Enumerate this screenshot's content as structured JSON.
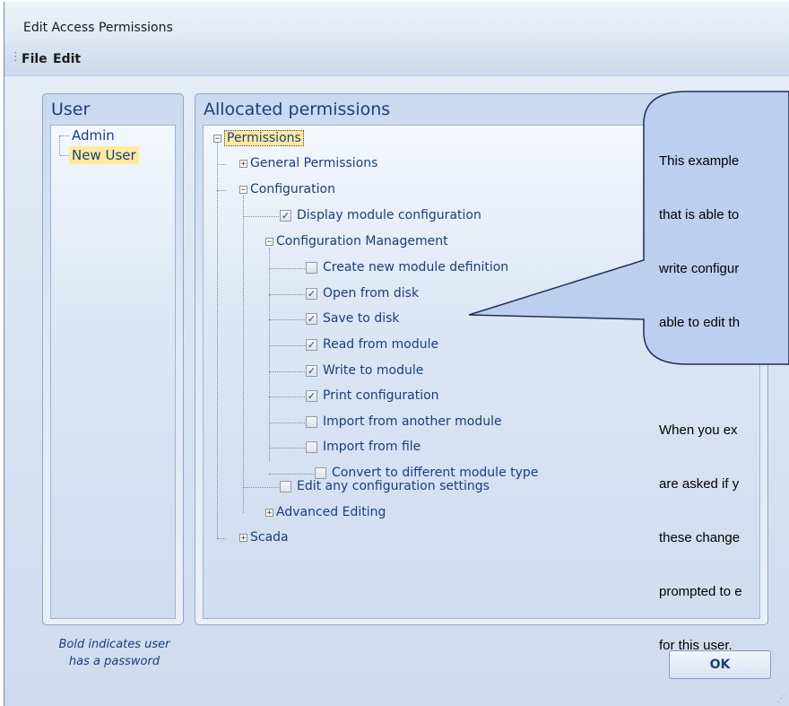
{
  "window": {
    "title": "Edit Access Permissions"
  },
  "menu": {
    "items": [
      "File",
      "Edit"
    ]
  },
  "user_panel": {
    "title": "User",
    "users": [
      "Admin",
      "New User"
    ]
  },
  "permissions_panel": {
    "title": "Allocated permissions",
    "tree": {
      "root": "Permissions",
      "general": "General Permissions",
      "configuration": "Configuration",
      "display_module_configuration": {
        "label": "Display module configuration",
        "checked": true
      },
      "configuration_management": "Configuration Management",
      "items": [
        {
          "label": "Create new module definition",
          "checked": false
        },
        {
          "label": "Open from disk",
          "checked": true
        },
        {
          "label": "Save to disk",
          "checked": true
        },
        {
          "label": "Read from module",
          "checked": true
        },
        {
          "label": "Write to module",
          "checked": true
        },
        {
          "label": "Print configuration",
          "checked": true
        },
        {
          "label": "Import from another module",
          "checked": false
        },
        {
          "label": "Import from file",
          "checked": false
        },
        {
          "label": "Convert to different module type",
          "checked": false
        }
      ],
      "edit_any": {
        "label": "Edit any configuration settings",
        "checked": false
      },
      "advanced_editing": "Advanced Editing",
      "scada": "Scada"
    }
  },
  "legend": {
    "line1": "Bold indicates user",
    "line2": "has a password"
  },
  "buttons": {
    "ok": "OK"
  },
  "callout": {
    "lines": [
      "This example",
      "that is able to",
      "write configur",
      "able to edit th",
      "",
      "When you ex",
      "are asked if y",
      "these change",
      "prompted to e",
      "for this user."
    ]
  },
  "icons": {
    "expand": "plus-box-icon",
    "collapse": "minus-box-icon",
    "check": "checkmark-icon"
  }
}
